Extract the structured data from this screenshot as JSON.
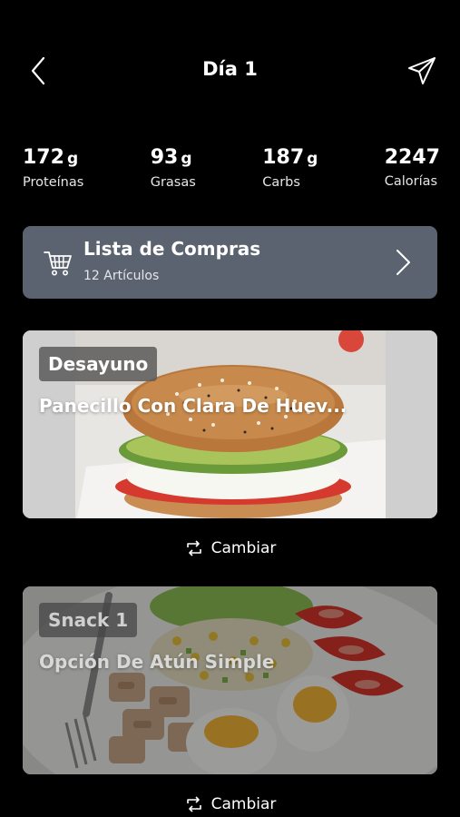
{
  "header": {
    "title": "Día 1"
  },
  "macros": [
    {
      "value": "172",
      "unit": "g",
      "label": "Proteínas"
    },
    {
      "value": "93",
      "unit": "g",
      "label": "Grasas"
    },
    {
      "value": "187",
      "unit": "g",
      "label": "Carbs"
    },
    {
      "value": "2247",
      "unit": "",
      "label": "Calorías"
    }
  ],
  "shopping": {
    "title": "Lista de Compras",
    "subtitle": "12 Artículos"
  },
  "meals": [
    {
      "badge": "Desayuno",
      "name": "Panecillo Con Clara De Huev...",
      "change_label": "Cambiar"
    },
    {
      "badge": "Snack 1",
      "name": "Opción De Atún Simple",
      "change_label": "Cambiar"
    }
  ],
  "icons": {
    "back": "chevron-left-icon",
    "share": "paper-plane-icon",
    "cart": "shopping-cart-icon",
    "chevron": "chevron-right-icon",
    "change": "swap-arrows-icon"
  }
}
